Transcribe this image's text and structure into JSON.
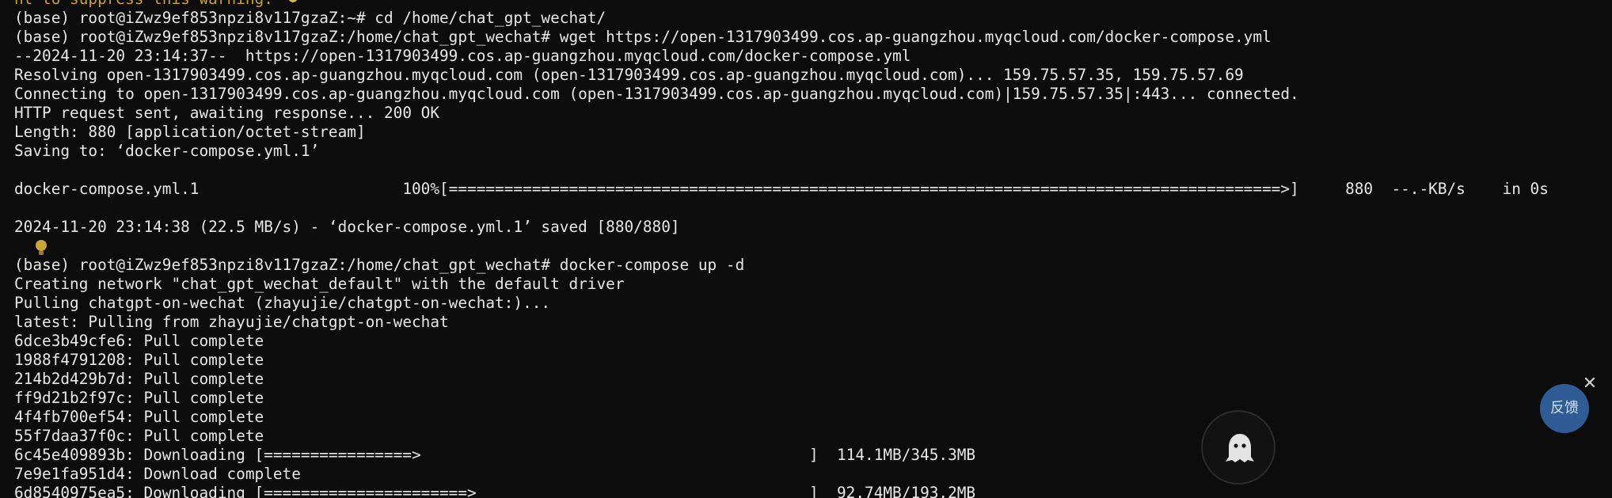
{
  "terminal": {
    "lines": [
      "nt to suppress this warning.",
      "(base) root@iZwz9ef853npzi8v117gzaZ:~# cd /home/chat_gpt_wechat/",
      "(base) root@iZwz9ef853npzi8v117gzaZ:/home/chat_gpt_wechat# wget https://open-1317903499.cos.ap-guangzhou.myqcloud.com/docker-compose.yml",
      "--2024-11-20 23:14:37--  https://open-1317903499.cos.ap-guangzhou.myqcloud.com/docker-compose.yml",
      "Resolving open-1317903499.cos.ap-guangzhou.myqcloud.com (open-1317903499.cos.ap-guangzhou.myqcloud.com)... 159.75.57.35, 159.75.57.69",
      "Connecting to open-1317903499.cos.ap-guangzhou.myqcloud.com (open-1317903499.cos.ap-guangzhou.myqcloud.com)|159.75.57.35|:443... connected.",
      "HTTP request sent, awaiting response... 200 OK",
      "Length: 880 [application/octet-stream]",
      "Saving to: ‘docker-compose.yml.1’",
      "",
      "docker-compose.yml.1                      100%[==========================================================================================>]     880  --.-KB/s    in 0s",
      "",
      "2024-11-20 23:14:38 (22.5 MB/s) - ‘docker-compose.yml.1’ saved [880/880]",
      "",
      "(base) root@iZwz9ef853npzi8v117gzaZ:/home/chat_gpt_wechat# docker-compose up -d",
      "Creating network \"chat_gpt_wechat_default\" with the default driver",
      "Pulling chatgpt-on-wechat (zhayujie/chatgpt-on-wechat:)...",
      "latest: Pulling from zhayujie/chatgpt-on-wechat",
      "6dce3b49cfe6: Pull complete",
      "1988f4791208: Pull complete",
      "214b2d429b7d: Pull complete",
      "ff9d21b2f97c: Pull complete",
      "4f4fb700ef54: Pull complete",
      "55f7daa37f0c: Pull complete",
      "6c45e409893b: Downloading [================>                                          ]  114.1MB/345.3MB",
      "7e9e1fa951d4: Download complete",
      "6d8540975ea5: Downloading [======================>                                    ]  92.74MB/193.2MB"
    ]
  },
  "widgets": {
    "feedback_label": "反馈",
    "close_symbol": "✕",
    "ghost_icon": "ghost-icon",
    "bulb_icon": "lightbulb-icon"
  },
  "colors": {
    "background": "#0c0c0c",
    "text": "#e8e8e8",
    "warning": "#c9a227",
    "feedback": "#2f5c95"
  }
}
